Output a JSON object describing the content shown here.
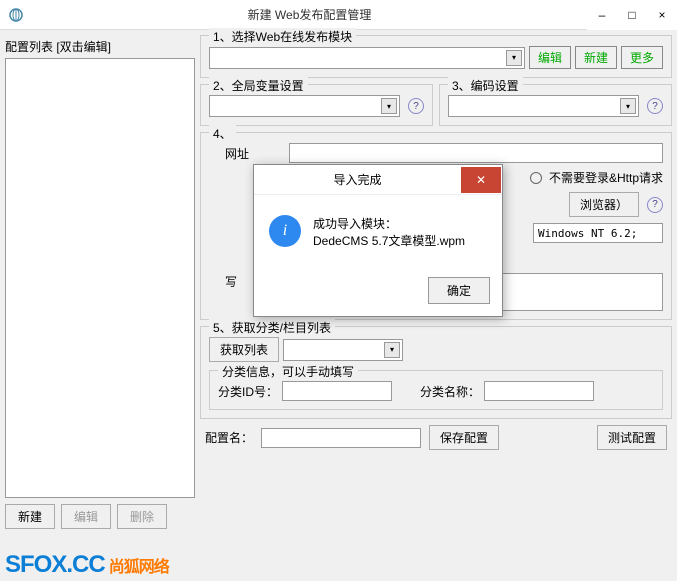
{
  "window": {
    "title": "新建 Web发布配置管理",
    "minimize": "–",
    "maximize": "□",
    "close": "×"
  },
  "left": {
    "label": "配置列表    [双击编辑]",
    "new": "新建",
    "edit": "编辑",
    "delete": "删除"
  },
  "sec1": {
    "title": "1、选择Web在线发布模块",
    "edit": "编辑",
    "new": "新建",
    "more": "更多"
  },
  "sec2": {
    "title": "2、全局变量设置"
  },
  "sec3": {
    "title": "3、编码设置"
  },
  "sec4": {
    "title": "4、",
    "addr_label": "网址",
    "radio_no_login": "不需要登录&Http请求",
    "browser_btn": "浏览器）",
    "ua_value": "Windows NT 6.2;",
    "write_label": "写"
  },
  "sec5": {
    "title": "5、获取分类/栏目列表",
    "get_list": "获取列表",
    "sub_label": "分类信息，可以手动填写",
    "id_label": "分类ID号：",
    "name_label": "分类名称："
  },
  "bottom": {
    "config_name": "配置名：",
    "save": "保存配置",
    "test": "测试配置"
  },
  "dialog": {
    "title": "导入完成",
    "line1": "成功导入模块：",
    "line2": "DedeCMS 5.7文章模型.wpm",
    "ok": "确定"
  },
  "watermark": {
    "en": "SFOX.CC",
    "cn": "尚狐网络"
  }
}
